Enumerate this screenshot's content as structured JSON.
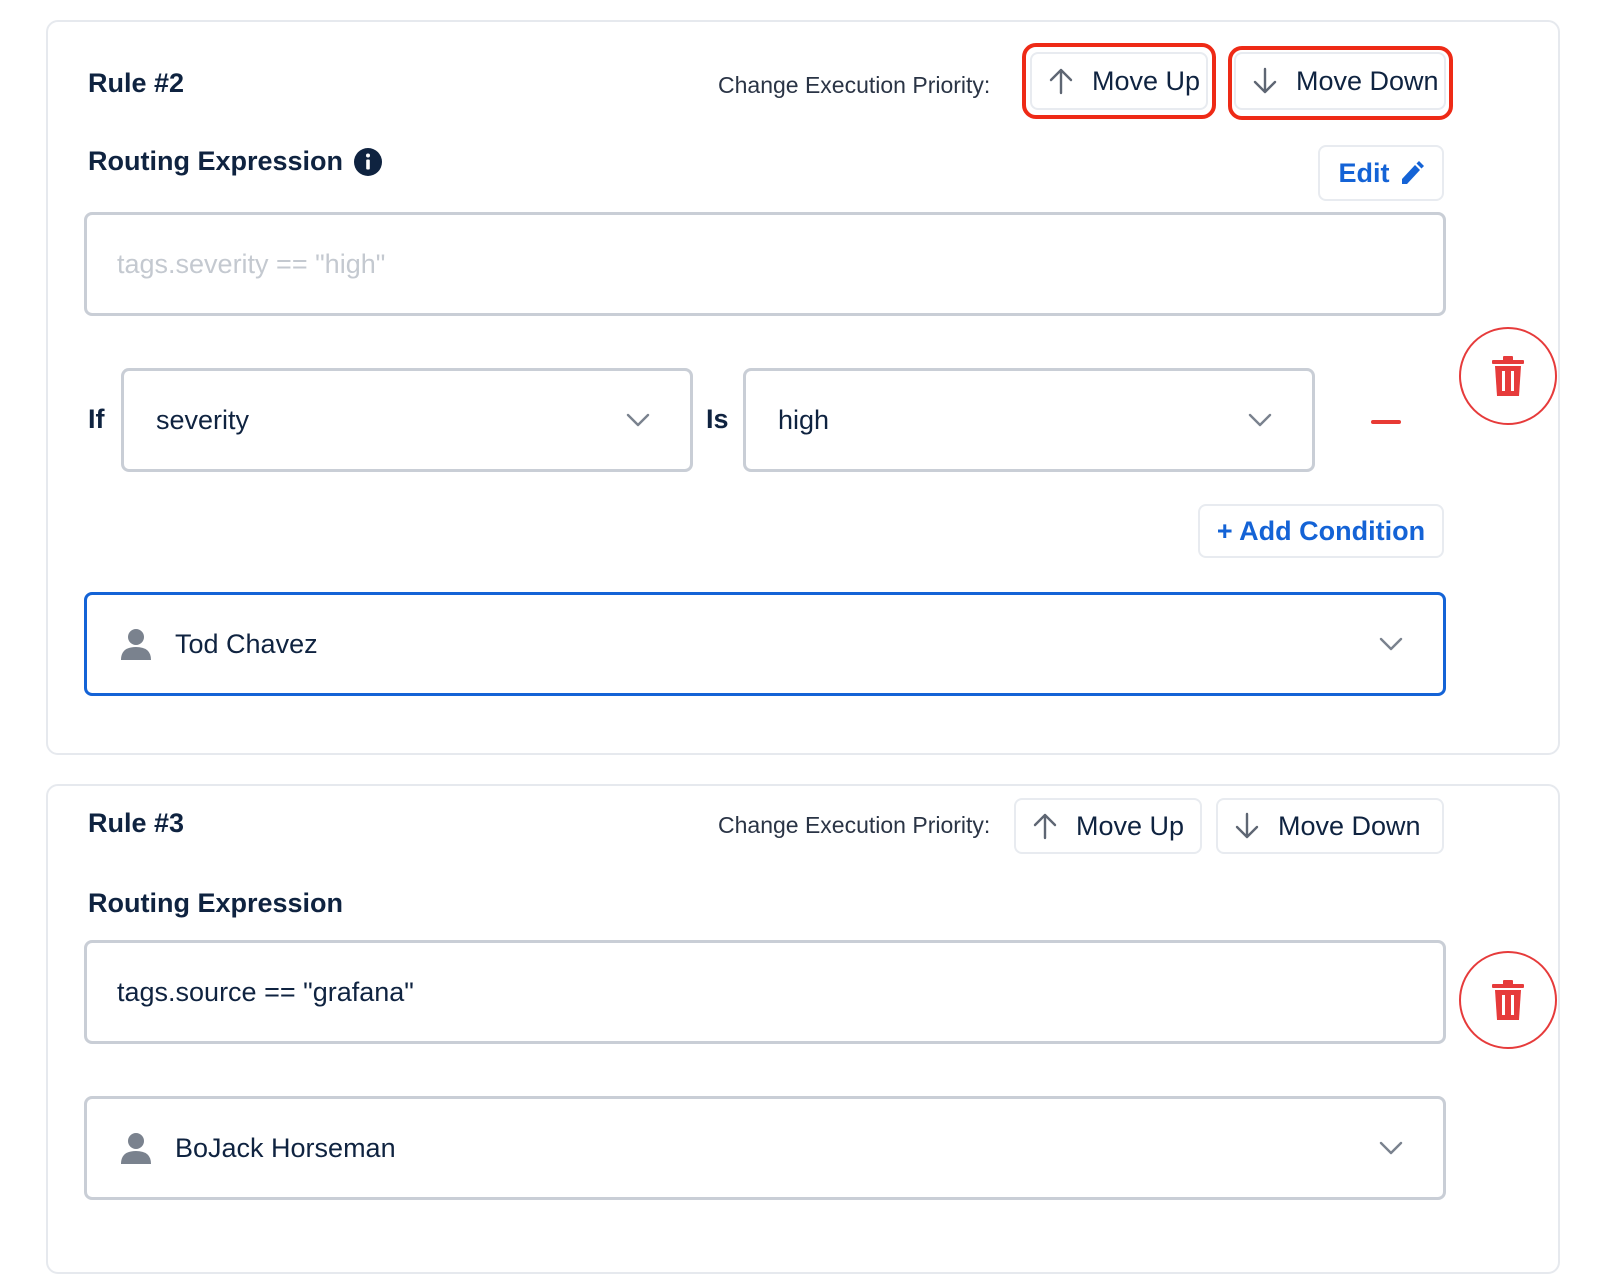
{
  "colors": {
    "accent": "#1463d6",
    "danger": "#e63b3b",
    "highlight": "#ee2a16",
    "text": "#0f2340"
  },
  "rule2": {
    "title": "Rule #2",
    "priority_label": "Change Execution Priority:",
    "move_up_label": "Move Up",
    "move_down_label": "Move Down",
    "routing_label": "Routing Expression",
    "info_icon": "info-icon",
    "edit_label": "Edit",
    "edit_icon": "pencil-icon",
    "expression_placeholder": "tags.severity == \"high\"",
    "if_label": "If",
    "field_value": "severity",
    "is_label": "Is",
    "match_value": "high",
    "add_condition_label": "+ Add Condition",
    "assignee": "Tod Chavez"
  },
  "rule3": {
    "title": "Rule #3",
    "priority_label": "Change Execution Priority:",
    "move_up_label": "Move Up",
    "move_down_label": "Move Down",
    "routing_label": "Routing Expression",
    "expression_value": "tags.source == \"grafana\"",
    "assignee": "BoJack Horseman"
  }
}
